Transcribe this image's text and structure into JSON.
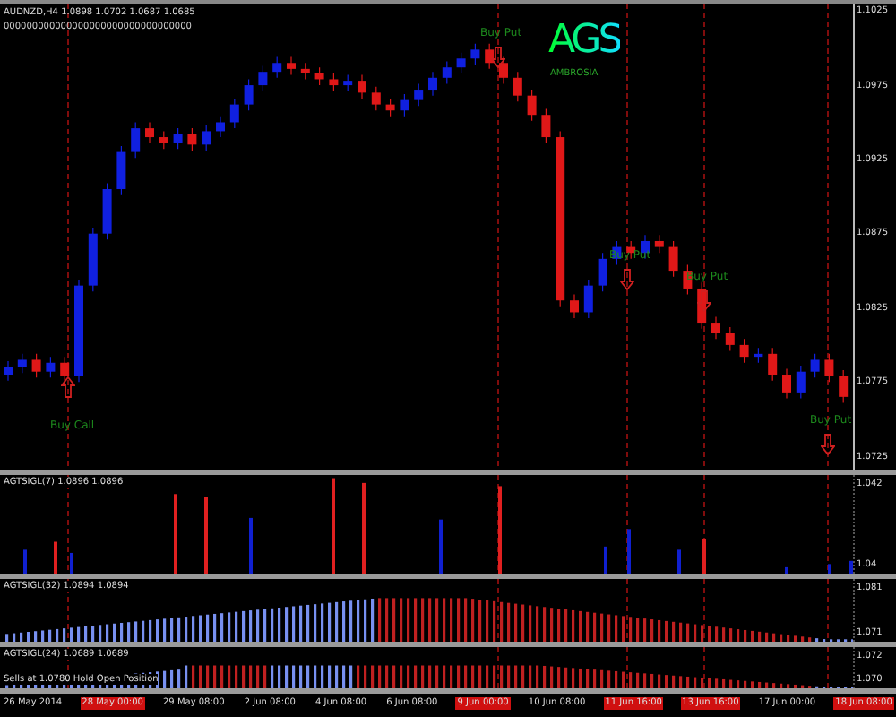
{
  "logo": {
    "text": "AGS",
    "caption": "AMBROSIA"
  },
  "signals": [
    {
      "label": "Buy Call",
      "kind": "call"
    },
    {
      "label": "Buy Put",
      "kind": "put"
    },
    {
      "label": "Buy Put",
      "kind": "put"
    },
    {
      "label": "Buy Put",
      "kind": "put"
    },
    {
      "label": "Buy Put",
      "kind": "put"
    }
  ],
  "chart": {
    "title": "AUDNZD,H4 1.0898 1.0702 1.0687 1.0685",
    "header": "000000000000000000000000000000000",
    "chart_data": {
      "type": "candlestick",
      "grid": true,
      "ylim": [
        1.0716,
        1.103
      ],
      "yticks": [
        1.1025,
        1.0975,
        1.0925,
        1.0875,
        1.0825,
        1.0775,
        1.0725
      ],
      "ohlc": [
        [
          1.078,
          1.0789,
          1.0776,
          1.0785
        ],
        [
          1.0785,
          1.0794,
          1.0781,
          1.079
        ],
        [
          1.079,
          1.0794,
          1.0778,
          1.0782
        ],
        [
          1.0782,
          1.0792,
          1.0778,
          1.0788
        ],
        [
          1.0788,
          1.0792,
          1.0775,
          1.0779
        ],
        [
          1.0779,
          1.0844,
          1.0775,
          1.084
        ],
        [
          1.084,
          1.0879,
          1.0836,
          1.0875
        ],
        [
          1.0875,
          1.0909,
          1.0871,
          1.0905
        ],
        [
          1.0905,
          1.0934,
          1.0901,
          1.093
        ],
        [
          1.093,
          1.095,
          1.0926,
          1.0946
        ],
        [
          1.0946,
          1.095,
          1.0936,
          1.094
        ],
        [
          1.094,
          1.0944,
          1.0932,
          1.0936
        ],
        [
          1.0936,
          1.0946,
          1.0932,
          1.0942
        ],
        [
          1.0942,
          1.0946,
          1.0931,
          1.0935
        ],
        [
          1.0935,
          1.0948,
          1.0931,
          1.0944
        ],
        [
          1.0944,
          1.0954,
          1.094,
          1.095
        ],
        [
          1.095,
          1.0966,
          1.0946,
          1.0962
        ],
        [
          1.0962,
          1.0979,
          1.0958,
          1.0975
        ],
        [
          1.0975,
          1.0988,
          1.0971,
          1.0984
        ],
        [
          1.0984,
          1.0994,
          1.098,
          1.099
        ],
        [
          1.099,
          1.0994,
          1.0982,
          1.0986
        ],
        [
          1.0986,
          1.099,
          1.0979,
          1.0983
        ],
        [
          1.0983,
          1.0987,
          1.0975,
          1.0979
        ],
        [
          1.0979,
          1.0983,
          1.0971,
          1.0975
        ],
        [
          1.0975,
          1.0982,
          1.0971,
          1.0978
        ],
        [
          1.0978,
          1.0982,
          1.0966,
          1.097
        ],
        [
          1.097,
          1.0974,
          1.0958,
          1.0962
        ],
        [
          1.0962,
          1.0966,
          1.0954,
          1.0958
        ],
        [
          1.0958,
          1.0969,
          1.0954,
          1.0965
        ],
        [
          1.0965,
          1.0976,
          1.0961,
          1.0972
        ],
        [
          1.0972,
          1.0984,
          1.0968,
          1.098
        ],
        [
          1.098,
          1.0991,
          1.0976,
          1.0987
        ],
        [
          1.0987,
          1.0997,
          1.0983,
          1.0993
        ],
        [
          1.0993,
          1.1003,
          1.0989,
          1.0999
        ],
        [
          1.0999,
          1.1003,
          1.0986,
          1.099
        ],
        [
          1.099,
          1.0994,
          1.0976,
          1.098
        ],
        [
          1.098,
          1.0984,
          1.0964,
          1.0968
        ],
        [
          1.0968,
          1.0972,
          1.0951,
          1.0955
        ],
        [
          1.0955,
          1.0959,
          1.0936,
          1.094
        ],
        [
          1.094,
          1.0944,
          1.0826,
          1.083
        ],
        [
          1.083,
          1.0834,
          1.0818,
          1.0822
        ],
        [
          1.0822,
          1.0844,
          1.0818,
          1.084
        ],
        [
          1.084,
          1.0862,
          1.0836,
          1.0858
        ],
        [
          1.0858,
          1.087,
          1.0854,
          1.0866
        ],
        [
          1.0866,
          1.087,
          1.0858,
          1.0862
        ],
        [
          1.0862,
          1.0874,
          1.0858,
          1.087
        ],
        [
          1.087,
          1.0874,
          1.0862,
          1.0866
        ],
        [
          1.0866,
          1.087,
          1.0846,
          1.085
        ],
        [
          1.085,
          1.0854,
          1.0834,
          1.0838
        ],
        [
          1.0838,
          1.0842,
          1.0811,
          1.0815
        ],
        [
          1.0815,
          1.0819,
          1.0804,
          1.0808
        ],
        [
          1.0808,
          1.0812,
          1.0796,
          1.08
        ],
        [
          1.08,
          1.0804,
          1.0788,
          1.0792
        ],
        [
          1.0792,
          1.0798,
          1.0788,
          1.0794
        ],
        [
          1.0794,
          1.0798,
          1.0776,
          1.078
        ],
        [
          1.078,
          1.0784,
          1.0764,
          1.0768
        ],
        [
          1.0768,
          1.0786,
          1.0764,
          1.0782
        ],
        [
          1.0782,
          1.0794,
          1.0778,
          1.079
        ],
        [
          1.079,
          1.0794,
          1.0775,
          1.0779
        ],
        [
          1.0779,
          1.0783,
          1.0761,
          1.0765
        ]
      ]
    }
  },
  "indicators": [
    {
      "label": "AGTSIGL(7) 1.0896 1.0896",
      "kind": "spikes",
      "axis": [
        "1.042",
        "1.04"
      ]
    },
    {
      "label": "AGTSIGL(32) 1.0894 1.0894",
      "kind": "wave",
      "axis": [
        "1.081",
        "1.071"
      ]
    },
    {
      "label": "AGTSIGL(24) 1.0689 1.0689",
      "kind": "wave2",
      "axis": [
        "1.072",
        "1.070"
      ],
      "note": "Sells at 1.0780 Hold Open Position"
    }
  ],
  "time_axis": [
    {
      "label": "26 May 2014",
      "highlighted": false
    },
    {
      "label": "28 May 00:00",
      "highlighted": true
    },
    {
      "label": "29 May 08:00",
      "highlighted": false
    },
    {
      "label": "2 Jun 08:00",
      "highlighted": false
    },
    {
      "label": "4 Jun 08:00",
      "highlighted": false
    },
    {
      "label": "6 Jun 08:00",
      "highlighted": false
    },
    {
      "label": "9 Jun 00:00",
      "highlighted": true
    },
    {
      "label": "10 Jun 08:00",
      "highlighted": false
    },
    {
      "label": "11 Jun 16:00",
      "highlighted": true
    },
    {
      "label": "13 Jun 16:00",
      "highlighted": true
    },
    {
      "label": "17 Jun 00:00",
      "highlighted": false
    },
    {
      "label": "18 Jun 08:00",
      "highlighted": true
    }
  ]
}
